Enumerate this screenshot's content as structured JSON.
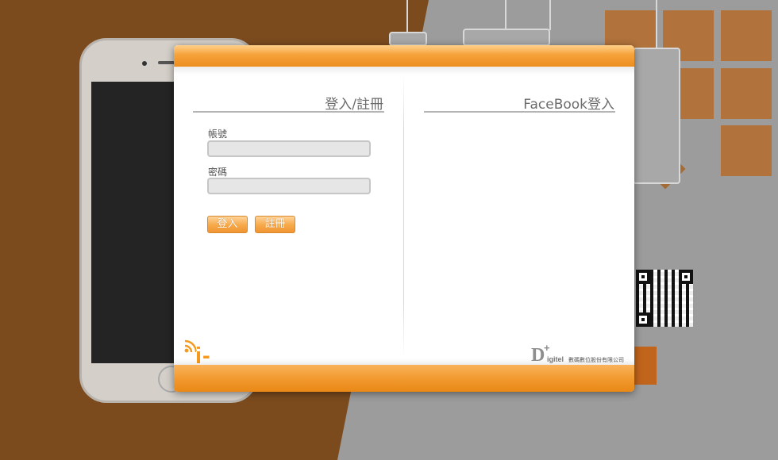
{
  "background": {
    "brown": "#7b4b1e",
    "gray": "#9c9c9c",
    "tile_color": "#b56b2a"
  },
  "dialog": {
    "accent_color": "#f29a30",
    "login_section": {
      "title": "登入/註冊",
      "account_label": "帳號",
      "account_value": "",
      "password_label": "密碼",
      "password_value": "",
      "login_button": "登入",
      "register_button": "註冊"
    },
    "facebook_section": {
      "title": "FaceBook登入"
    },
    "logos": {
      "iapp": "i-App",
      "digitel_mark": "D",
      "digitel_plus": "+",
      "digitel_word": "igitel",
      "digitel_company": "數碼數位股份有限公司"
    }
  }
}
